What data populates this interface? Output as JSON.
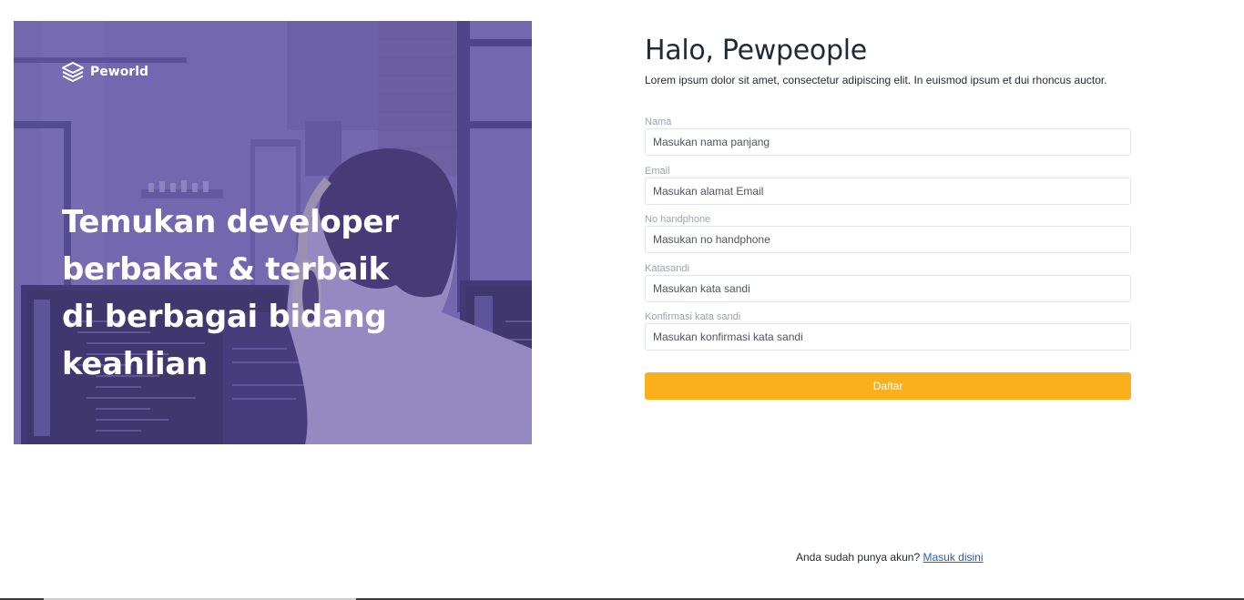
{
  "brand": {
    "name": "Peworld"
  },
  "hero": {
    "headline_lines": [
      "Temukan developer",
      "berbakat & terbaik",
      "di berbagai bidang",
      "keahlian"
    ]
  },
  "form": {
    "title": "Halo, Pewpeople",
    "subtitle": "Lorem ipsum dolor sit amet, consectetur adipiscing elit. In euismod ipsum et dui rhoncus auctor.",
    "fields": [
      {
        "label": "Nama",
        "placeholder": "Masukan nama panjang",
        "value": ""
      },
      {
        "label": "Email",
        "placeholder": "Masukan alamat Email",
        "value": ""
      },
      {
        "label": "No handphone",
        "placeholder": "Masukan no handphone",
        "value": ""
      },
      {
        "label": "Katasandi",
        "placeholder": "Masukan kata sandi",
        "value": ""
      },
      {
        "label": "Konfirmasi kata sandi",
        "placeholder": "Masukan konfirmasi kata sandi",
        "value": ""
      }
    ],
    "submit_label": "Daftar"
  },
  "login_prompt": {
    "text": "Anda sudah punya akun?",
    "link_label": "Masuk disini"
  },
  "colors": {
    "accent": "#f9b01a",
    "hero_overlay": "#5e50a1",
    "link": "#2a5db0"
  },
  "icons": {
    "brand_logo": "layers-icon"
  }
}
